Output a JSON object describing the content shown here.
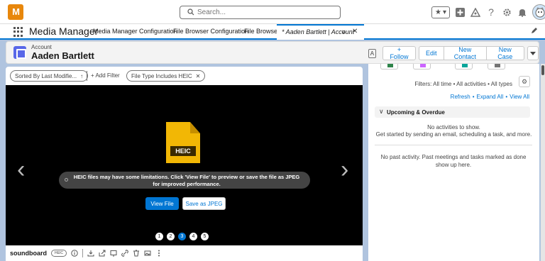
{
  "header": {
    "logo_text": "M",
    "logo_accent": "₃",
    "search_placeholder": "Search...",
    "fav_star": "★",
    "fav_caret": "▾"
  },
  "appnav": {
    "app_name": "Media Manager",
    "items": [
      "Media Manager Configuration",
      "File Browser Configuration",
      "File Browser"
    ],
    "active_tab": "* Aaden Bartlett | Account",
    "active_caret": "∨",
    "active_close": "✕"
  },
  "record": {
    "type": "Account",
    "name": "Aaden Bartlett",
    "follow_label": "+ Follow",
    "edit_label": "Edit",
    "new_contact_label": "New Contact",
    "new_case_label": "New Case",
    "mini_icon_text": "A"
  },
  "filters": {
    "sort_label": "Sorted By Last Modifie...",
    "sort_arrow": "↑",
    "add_filter_label": "+ Add Filter",
    "file_type_label": "File Type Includes HEIC",
    "file_type_close": "✕"
  },
  "viewer": {
    "heic_label": "HEIC",
    "prev_arrow": "‹",
    "next_arrow": "›",
    "warning": "HEIC files may have some limitations. Click 'View File' to preview or save the file as JPEG for improved performance.",
    "view_file_label": "View File",
    "save_jpeg_label": "Save as JPEG",
    "pages": [
      "1",
      "2",
      "3",
      "4",
      "5"
    ],
    "active_page": 3
  },
  "filebar": {
    "file_name": "soundboard",
    "badge": "HEIC"
  },
  "activity": {
    "filters_text": "Filters: All time • All activities • All types",
    "refresh": "Refresh",
    "expand_all": "Expand All",
    "view_all": "View All",
    "link_sep": "•",
    "upcoming_title": "Upcoming & Overdue",
    "no_activities": "No activities to show.",
    "get_started": "Get started by sending an email, scheduling a task, and more.",
    "no_past": "No past activity. Past meetings and tasks marked as done show up here."
  },
  "colors": {
    "brand_blue": "#0176d3",
    "logo_orange": "#e8870c",
    "heic_yellow": "#f2b705",
    "page_bg": "#b0c4df"
  }
}
